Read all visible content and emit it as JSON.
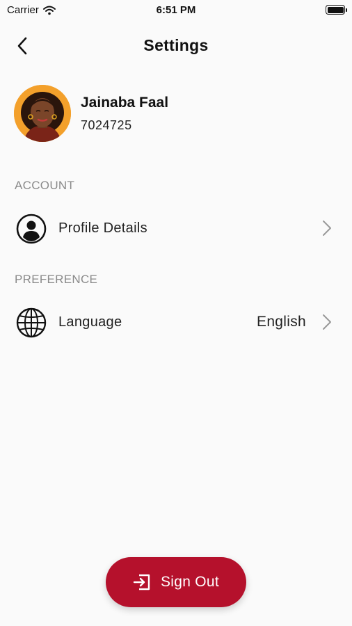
{
  "status_bar": {
    "carrier": "Carrier",
    "time": "6:51 PM"
  },
  "header": {
    "title": "Settings"
  },
  "profile": {
    "name": "Jainaba Faal",
    "id": "7024725"
  },
  "sections": {
    "account": {
      "title": "ACCOUNT",
      "items": [
        {
          "label": "Profile Details",
          "icon": "user-circle-icon"
        }
      ]
    },
    "preference": {
      "title": "PREFERENCE",
      "items": [
        {
          "label": "Language",
          "value": "English",
          "icon": "globe-icon"
        }
      ]
    }
  },
  "actions": {
    "sign_out": "Sign Out"
  },
  "colors": {
    "accent": "#b5112c",
    "background": "#fafafa",
    "avatar_bg": "#f3a02b"
  }
}
